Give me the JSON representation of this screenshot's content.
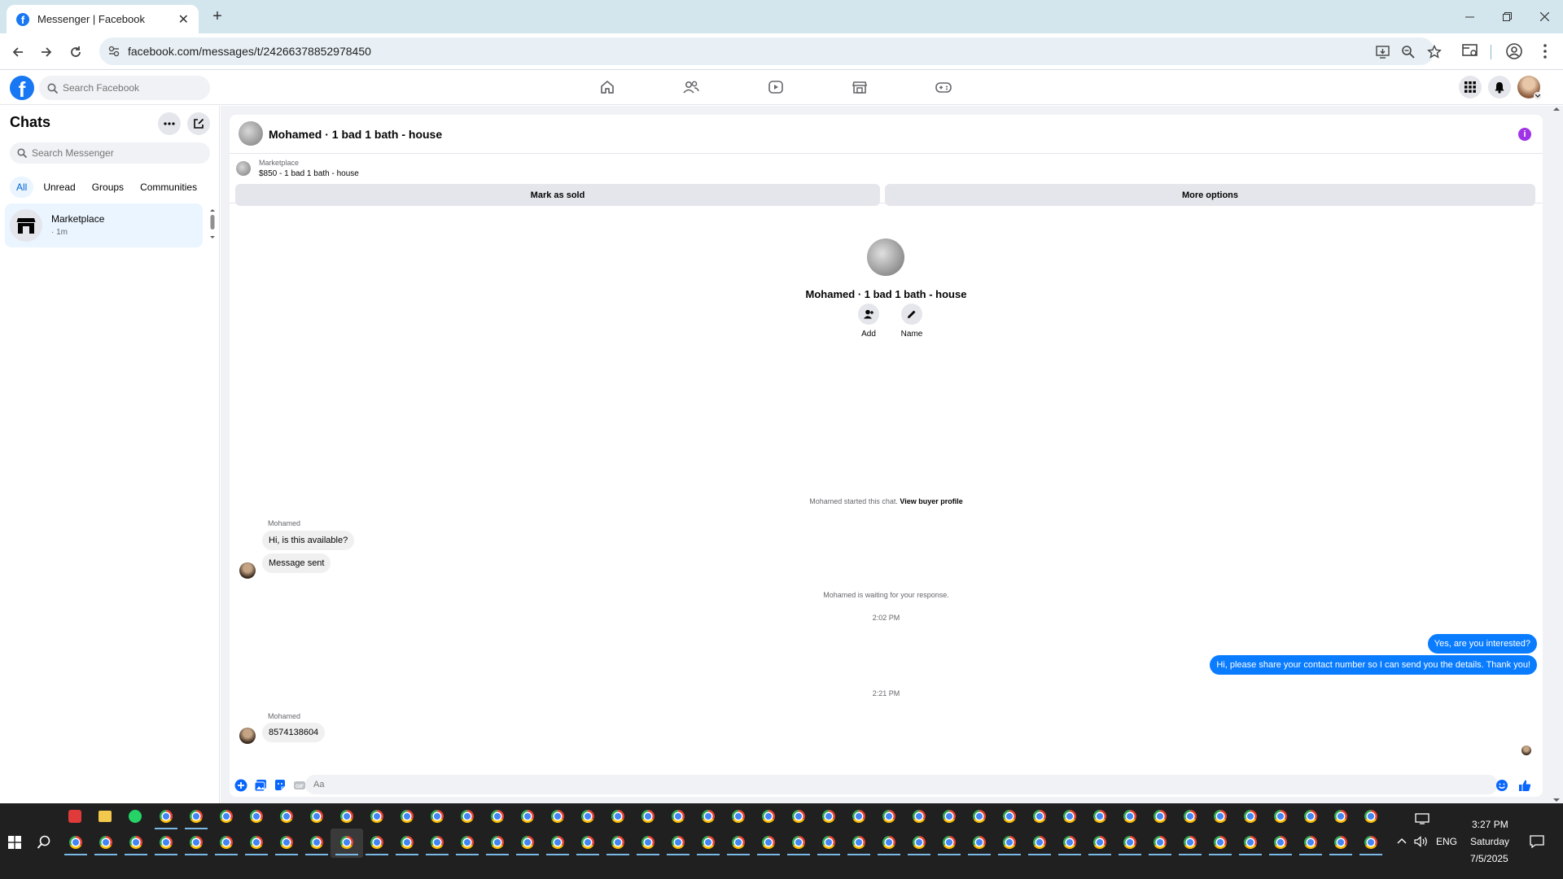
{
  "browser": {
    "tab_title": "Messenger | Facebook",
    "url": "facebook.com/messages/t/24266378852978450"
  },
  "facebook": {
    "search_placeholder": "Search Facebook"
  },
  "sidebar": {
    "title": "Chats",
    "search_placeholder": "Search Messenger",
    "filters": [
      "All",
      "Unread",
      "Groups",
      "Communities"
    ],
    "active_filter": "All",
    "chats": [
      {
        "name": "Marketplace",
        "time": "· 1m"
      }
    ]
  },
  "chat": {
    "header_name": "Mohamed · 1 bad 1 bath - house",
    "marketplace_label": "Marketplace",
    "listing": "$850 - 1 bad 1 bath - house",
    "mark_sold_label": "Mark as sold",
    "more_options_label": "More options",
    "profile_name": "Mohamed · 1 bad 1 bath - house",
    "actions": {
      "add": "Add",
      "name": "Name"
    },
    "started_note": "Mohamed started this chat.",
    "view_buyer_profile": "View buyer profile",
    "waiting_note": "Mohamed is waiting for your response.",
    "messages": [
      {
        "sender": "Mohamed",
        "text": "Hi, is this available?"
      },
      {
        "text": "Message sent"
      },
      {
        "timestamp": "2:02 PM"
      },
      {
        "out": true,
        "text": "Yes, are you interested?"
      },
      {
        "out": true,
        "text": "Hi, please share your contact number so I can send you the details. Thank you!"
      },
      {
        "timestamp": "2:21 PM"
      },
      {
        "sender": "Mohamed",
        "text": "8574138604"
      }
    ],
    "composer_placeholder": "Aa"
  },
  "taskbar": {
    "time": "3:27 PM",
    "day": "Saturday",
    "date": "7/5/2025",
    "language": "ENG"
  },
  "colors": {
    "fb_blue": "#1877f2",
    "bubble_out": "#0a7cff",
    "info_purple": "#a033e8",
    "taskbar_bg": "#202020"
  }
}
